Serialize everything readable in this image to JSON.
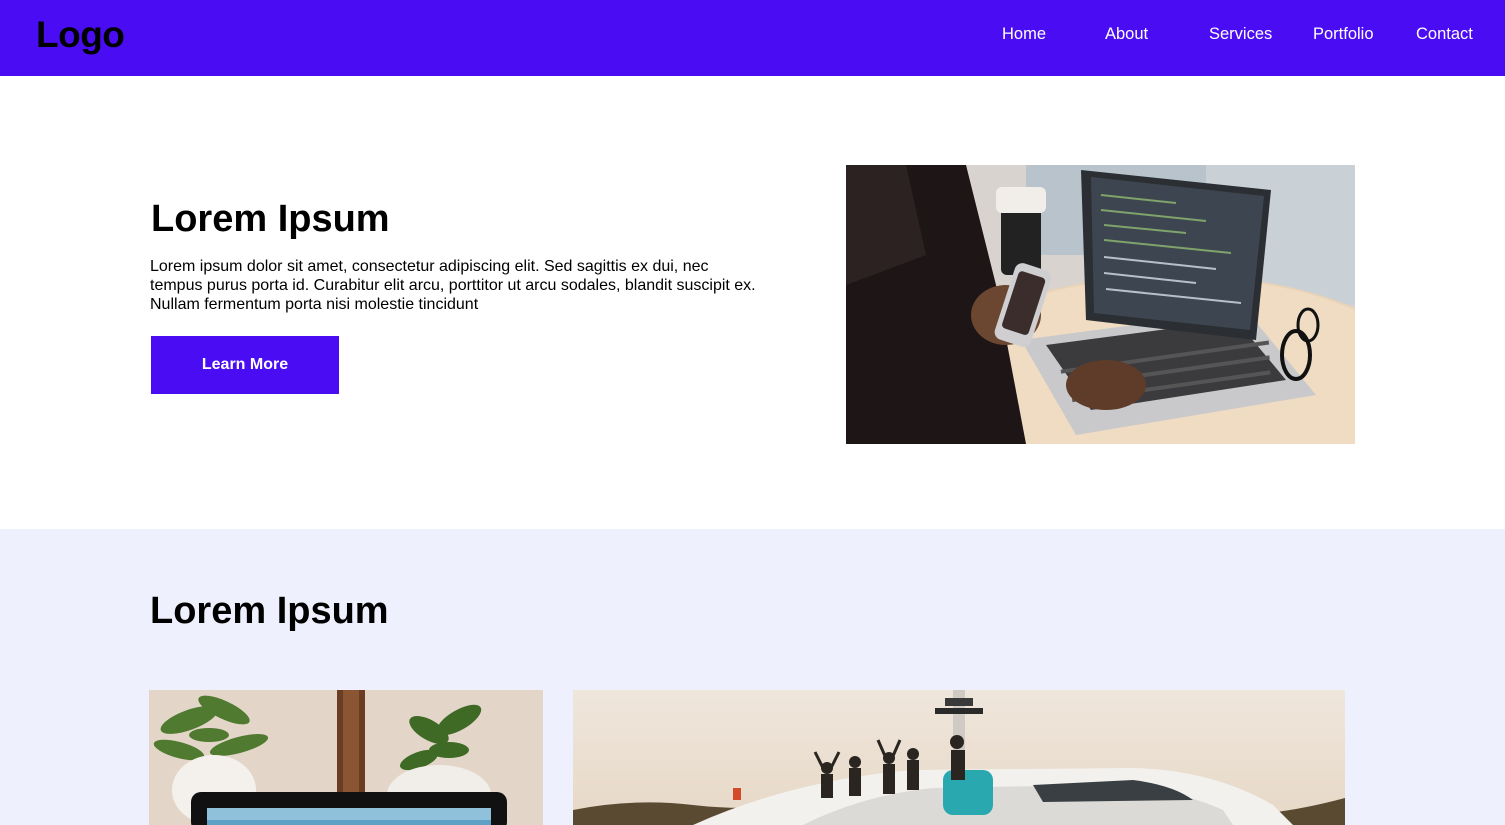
{
  "nav": {
    "logo": "Logo",
    "links": [
      "Home",
      "About",
      "Services",
      "Portfolio",
      "Contact"
    ],
    "background": "#4a0cf2"
  },
  "hero": {
    "title": "Lorem Ipsum",
    "text": "Lorem ipsum dolor sit amet, consectetur adipiscing elit. Sed sagittis ex dui, nec tempus purus porta id. Curabitur elit arcu, porttitor ut arcu sodales, blandit suscipit ex. Nullam fermentum porta nisi molestie tincidunt",
    "button_label": "Learn More",
    "accent": "#4a0cf2"
  },
  "section2": {
    "title": "Lorem Ipsum",
    "background": "#eef0fd"
  }
}
